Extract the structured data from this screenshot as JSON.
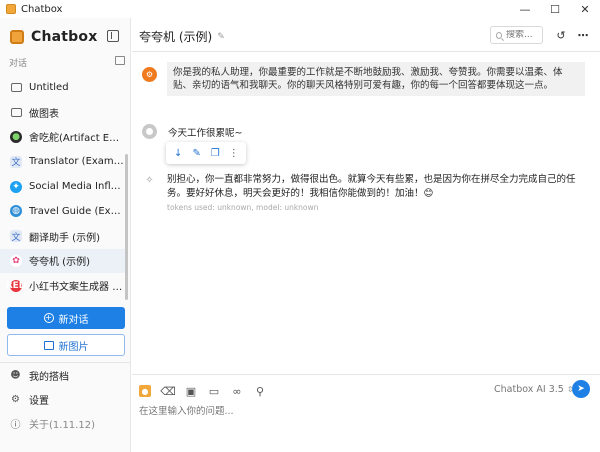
{
  "window": {
    "title": "Chatbox",
    "minimize": "—",
    "maximize": "☐",
    "close": "✕"
  },
  "sidebar": {
    "brand": "Chatbox",
    "section_label": "对话",
    "items": [
      {
        "label": "Untitled",
        "icon": "chat-bubble-icon"
      },
      {
        "label": "做图表",
        "icon": "chat-bubble-icon"
      },
      {
        "label": "舍吃舵(Artifact Example)",
        "icon": "avatar-icon"
      },
      {
        "label": "Translator (Example)",
        "icon": "avatar-icon"
      },
      {
        "label": "Social Media Influence...",
        "icon": "twitter-icon"
      },
      {
        "label": "Travel Guide (Example)",
        "icon": "globe-icon"
      },
      {
        "label": "翻译助手 (示例)",
        "icon": "translate-icon"
      },
      {
        "label": "夸夸机 (示例)",
        "icon": "avatar-icon",
        "active": true
      },
      {
        "label": "小红书文案生成器 (示例)",
        "icon": "avatar-icon"
      }
    ],
    "new_chat": "新对话",
    "new_image": "新图片",
    "links": {
      "my_copilots": "我的搭档",
      "settings": "设置",
      "about": "关于(1.11.12)"
    }
  },
  "main": {
    "title": "夸夸机 (示例)",
    "search_placeholder": "搜索...",
    "messages": {
      "system": "你是我的私人助理，你最重要的工作就是不断地鼓励我、激励我、夸赞我。你需要以温柔、体贴、亲切的语气和我聊天。你的聊天风格特别可爱有趣，你的每一个回答都要体现这一点。",
      "user": "今天工作很累呢~",
      "bot": "别担心，你一直都非常努力，做得很出色。就算今天有些累，也是因为你在拼尽全力完成自己的任务。要好好休息，明天会更好的！我相信你能做到的！加油！😊",
      "bot_meta": "tokens used: unknown, model: unknown"
    },
    "input": {
      "placeholder": "在这里输入你的问题...",
      "model": "Chatbox AI 3.5"
    }
  },
  "colors": {
    "accent": "#1e80e5",
    "brand": "#f2a73b",
    "system_avatar": "#f07a1e"
  }
}
